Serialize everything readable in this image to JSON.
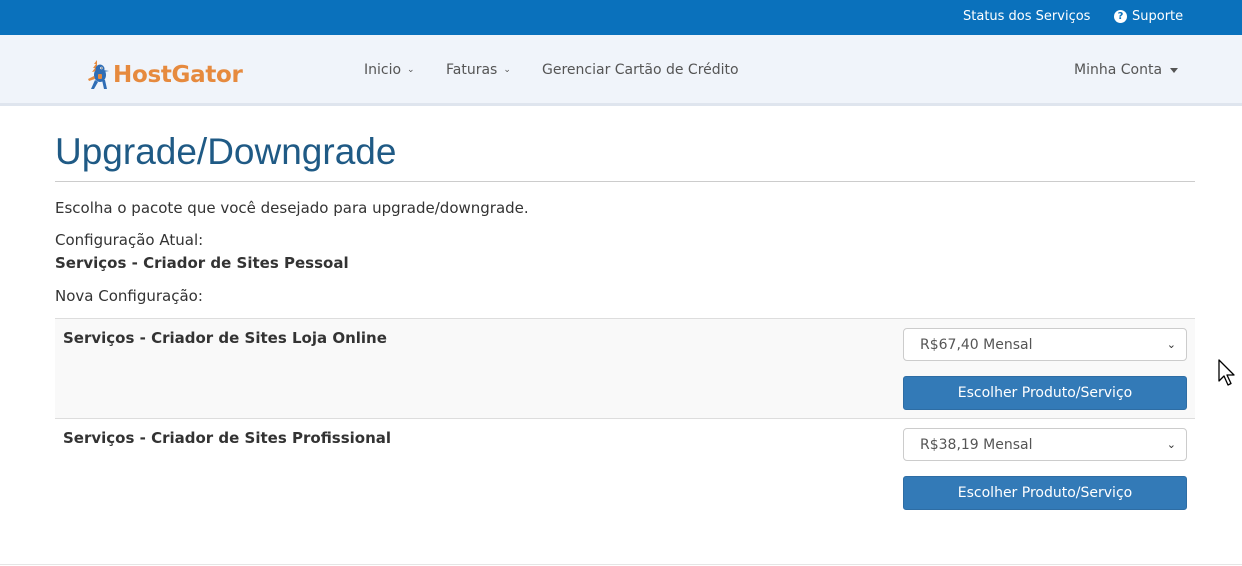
{
  "topbar": {
    "status_label": "Status dos Serviços",
    "support_label": "Suporte"
  },
  "brand": {
    "logo_text": "HostGator",
    "logo_color": "#e68a3e"
  },
  "nav": {
    "inicio": "Inicio",
    "faturas": "Faturas",
    "cartao": "Gerenciar Cartão de Crédito",
    "conta": "Minha Conta"
  },
  "page": {
    "title": "Upgrade/Downgrade",
    "intro": "Escolha o pacote que você desejado para upgrade/downgrade.",
    "current_label": "Configuração Atual:",
    "current_value": "Serviços - Criador de Sites Pessoal",
    "new_label": "Nova Configuração:"
  },
  "products": [
    {
      "name": "Serviços - Criador de Sites Loja Online",
      "price_option": "R$67,40 Mensal",
      "button_label": "Escolher Produto/Serviço"
    },
    {
      "name": "Serviços - Criador de Sites Profissional",
      "price_option": "R$38,19 Mensal",
      "button_label": "Escolher Produto/Serviço"
    }
  ],
  "colors": {
    "topbar": "#0a71bc",
    "navbar": "#f0f4fa",
    "title": "#1f5a85",
    "button": "#337ab7"
  }
}
